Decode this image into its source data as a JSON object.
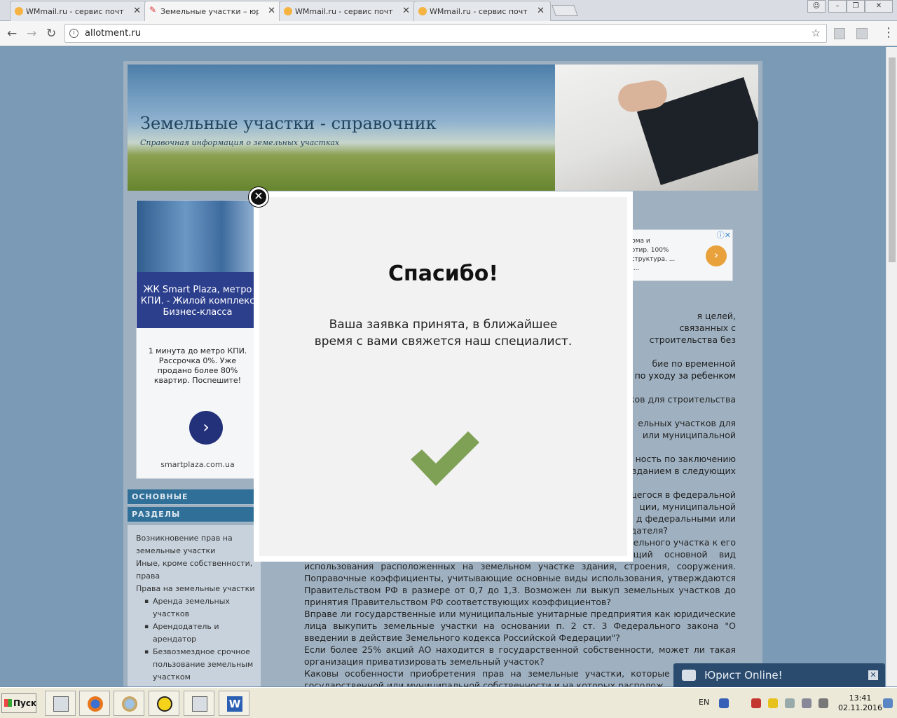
{
  "browser": {
    "tabs": [
      {
        "title": "WMmail.ru - сервис почтов",
        "active": false,
        "icon": "wmmail-favicon"
      },
      {
        "title": "Земельные участки – юри",
        "active": true,
        "icon": "pen-favicon"
      },
      {
        "title": "WMmail.ru - сервис почтов",
        "active": false,
        "icon": "wmmail-favicon"
      },
      {
        "title": "WMmail.ru - сервис почтов",
        "active": false,
        "icon": "wmmail-favicon"
      }
    ],
    "url": "allotment.ru"
  },
  "site": {
    "title": "Земельные участки - справочник",
    "subtitle": "Справочная информация о земельных участках",
    "left_ad": {
      "headline": "ЖК Smart Plaza, метро КПИ. - Жилой комплекс Бизнес-класса",
      "body": "1 минута до метро КПИ. Рассрочка 0%. Уже продано более 80% квартир. Поспешите!",
      "domain": "smartplaza.com.ua"
    },
    "sections": [
      "ОСНОВНЫЕ",
      "РАЗДЕЛЫ"
    ],
    "nav": [
      {
        "label": "Возникновение прав на земельные участки",
        "level": 0
      },
      {
        "label": "Иные, кроме собственности, права",
        "level": 0
      },
      {
        "label": "Права на земельные участки",
        "level": 0
      },
      {
        "label": "Аренда земельных участков",
        "level": 1
      },
      {
        "label": "Арендодатель и арендатор",
        "level": 1
      },
      {
        "label": "Безвозмездное срочное пользование земельным участком",
        "level": 1
      }
    ],
    "right_ad": {
      "line1": "дома и",
      "line2": "артир. 100%",
      "line3": "аструктура. ...",
      "line4": "m..."
    },
    "content": {
      "partial_link": "х",
      "fragments": [
        "я целей, связанных с",
        "строительства   без",
        "бие   по   временной",
        "ие по уходу за ребенком",
        "тков для строительства",
        "ельных   участков   для",
        "или   муниципальной",
        "ность по заключению",
        "зданием в следующих",
        "щегося в федеральной",
        "ции,       муниципальной",
        "д   федеральными   или",
        "одателя?",
        "емельного участка к его"
      ],
      "paragraphs": [
        "стоимости применяется поправочный коэффициент, учитывающий основной вид использования расположенных на земельном участке здания, строения, сооружения. Поправочные коэффициенты, учитывающие основные виды использования, утверждаются Правительством РФ в размере от 0,7 до 1,3. Возможен ли выкуп земельных участков до принятия Правительством РФ соответствующих коэффициентов?",
        "Вправе ли государственные или муниципальные унитарные предприятия как юридические лица выкупить земельные участки на основании п. 2 ст. 3 Федерального закона \"О введении в действие Земельного кодекса Российской Федерации\"?",
        "Если более 25% акций АО находится в государственной собственности, может ли такая организация приватизировать земельный участок?",
        "Каковы особенности приобретения прав на земельные участки, которые находятся в государственной или муниципальной собственности и на которых располож"
      ]
    }
  },
  "modal": {
    "title": "Спасибо!",
    "message": "Ваша заявка принята, в ближайшее время с вами свяжется наш специалист.",
    "check_color": "#7fa155"
  },
  "chat": {
    "label": "Юрист Online!"
  },
  "taskbar": {
    "start_label": "Пуск",
    "lang": "EN",
    "time": "13:41",
    "date": "02.11.2016",
    "apps": [
      "files-app",
      "firefox",
      "paint",
      "cyberghost",
      "files-app-2",
      "word"
    ]
  }
}
